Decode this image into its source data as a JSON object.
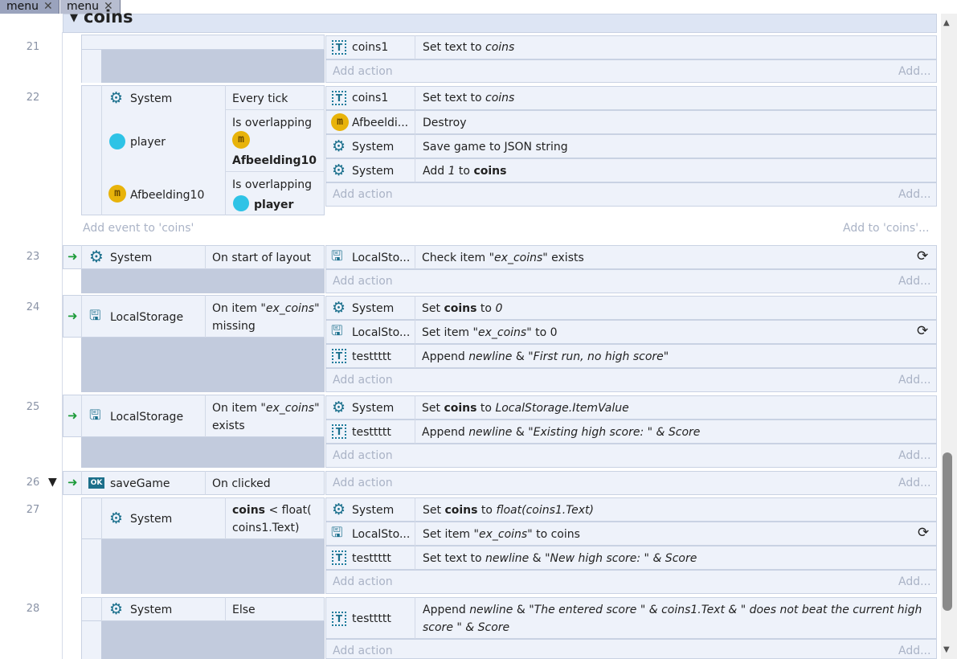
{
  "tabs": [
    {
      "label": "menu",
      "close": "✕"
    },
    {
      "label": "menu",
      "close": "✕"
    }
  ],
  "group": {
    "title": "coins",
    "add_event": "Add event to 'coins'",
    "add_to": "Add to 'coins'..."
  },
  "add_action": "Add action",
  "add_more": "Add...",
  "events": {
    "e21": {
      "num": "21",
      "actions": [
        {
          "obj": "coins1",
          "text": "Set text to ",
          " v": "",
          "val": "coins"
        }
      ]
    },
    "e22": {
      "num": "22",
      "cond_system": "System",
      "cond_every": "Every tick",
      "cond_player": "player",
      "cond_overlap1": "Is overlapping",
      "cond_afb": "Afbeelding10",
      "cond_afb_obj": "Afbeelding10",
      "cond_overlap2": "Is overlapping",
      "cond_player2": "player",
      "a1_obj": "coins1",
      "a1_txt": "Set text to ",
      "a1_val": "coins",
      "a2_obj": "Afbeeldi...",
      "a2_txt": "Destroy",
      "a3_obj": "System",
      "a3_txt": "Save game to JSON string",
      "a4_obj": "System",
      "a4_txt1": "Add ",
      "a4_val": "1",
      "a4_txt2": " to ",
      "a4_bold": "coins"
    },
    "e23": {
      "num": "23",
      "cond_obj": "System",
      "cond_txt": "On start of layout",
      "a1_obj": "LocalSto...",
      "a1_txt1": "Check item \"",
      "a1_val": "ex_coins",
      "a1_txt2": "\" exists"
    },
    "e24": {
      "num": "24",
      "cond_obj": "LocalStorage",
      "cond_txt1": "On item \"",
      "cond_val": "ex_coins",
      "cond_txt2": "\"",
      "cond_txt3": "missing",
      "a1_obj": "System",
      "a1_txt1": "Set ",
      "a1_bold": "coins",
      "a1_txt2": " to ",
      "a1_val": "0",
      "a2_obj": "LocalSto...",
      "a2_txt1": "Set item \"",
      "a2_val": "ex_coins",
      "a2_txt2": "\" to 0",
      "a3_obj": "testtttt",
      "a3_txt1": "Append ",
      "a3_val": "newline",
      "a3_txt2": " & ",
      "a3_val2": "\"First run, no high score\""
    },
    "e25": {
      "num": "25",
      "cond_obj": "LocalStorage",
      "cond_txt1": "On item \"",
      "cond_val": "ex_coins",
      "cond_txt2": "\"",
      "cond_txt3": "exists",
      "a1_obj": "System",
      "a1_txt1": "Set ",
      "a1_bold": "coins",
      "a1_txt2": " to ",
      "a1_val": "LocalStorage.ItemValue",
      "a2_obj": "testtttt",
      "a2_txt1": "Append ",
      "a2_val": "newline",
      "a2_txt2": " & ",
      "a2_val2": "\"Existing high score: \" & Score"
    },
    "e26": {
      "num": "26",
      "cond_obj": "saveGame",
      "cond_txt": "On clicked",
      "ok": "OK"
    },
    "e27": {
      "num": "27",
      "cond_obj": "System",
      "cond_bold": "coins",
      "cond_txt1": " < float(",
      "cond_txt2": "coins1.Text)",
      "a1_obj": "System",
      "a1_txt1": "Set ",
      "a1_bold": "coins",
      "a1_txt2": " to ",
      "a1_val": "float(coins1.Text)",
      "a2_obj": "LocalSto...",
      "a2_txt1": "Set item \"",
      "a2_val": "ex_coins",
      "a2_txt2": "\" to coins",
      "a3_obj": "testtttt",
      "a3_txt1": "Set text to ",
      "a3_val": "newline",
      "a3_txt2": " & ",
      "a3_val2": "\"New high score: \" & Score"
    },
    "e28": {
      "num": "28",
      "cond_obj": "System",
      "cond_txt": "Else",
      "a1_obj": "testtttt",
      "a1_txt1": "Append ",
      "a1_val": "newline",
      "a1_txt2": " & ",
      "a1_val2": "\"The entered score \" & coins1.Text & \" does not beat the current high",
      "a1_val3": "score \" & Score"
    }
  },
  "colors": {
    "accent": "#1a6f8c",
    "gray": "#c2cbdd",
    "cell": "#eef2fa",
    "coin": "#e8b30a",
    "player": "#2ec3e6"
  }
}
